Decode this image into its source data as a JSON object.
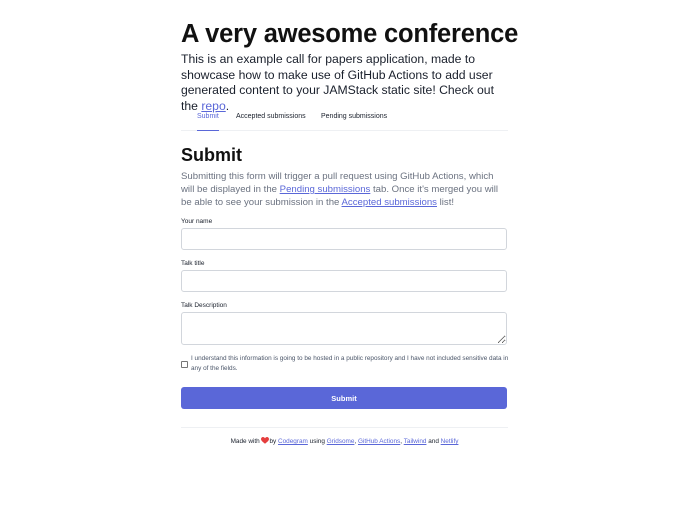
{
  "header": {
    "title": "A very awesome conference",
    "intro_text": "This is an example call for papers application, made to showcase how to make use of GitHub Actions to add user generated content to your JAMStack static site! Check out the ",
    "repo_link": "repo",
    "intro_end": "."
  },
  "tabs": [
    {
      "label": "Submit",
      "active": true
    },
    {
      "label": "Accepted submissions",
      "active": false
    },
    {
      "label": "Pending submissions",
      "active": false
    }
  ],
  "section": {
    "title": "Submit",
    "desc_part1": "Submitting this form will trigger a pull request using GitHub Actions, which will be displayed in the ",
    "desc_link1": "Pending submissions",
    "desc_part2": " tab. Once it's merged you will be able to see your submission in the ",
    "desc_link2": "Accepted submissions",
    "desc_part3": " list!"
  },
  "form": {
    "name_label": "Your name",
    "name_value": "",
    "title_label": "Talk title",
    "title_value": "",
    "description_label": "Talk Description",
    "description_value": "",
    "consent_text": "I understand this information is going to be hosted in a public repository and I have not included sensitive data in any of the fields.",
    "consent_checked": false,
    "submit_label": "Submit"
  },
  "footer": {
    "made_with": "Made with",
    "by": "by",
    "codegram": "Codegram",
    "using": "using",
    "gridsome": "Gridsome",
    "comma1": ",",
    "github_actions": "GitHub Actions",
    "comma2": ",",
    "tailwind": "Tailwind",
    "and": "and",
    "netlify": "Netlify"
  },
  "colors": {
    "accent": "#5a67d8",
    "heart": "#e53e3e",
    "muted_text": "#6b7280"
  },
  "icons": {
    "footer_icon": "heart-icon"
  }
}
